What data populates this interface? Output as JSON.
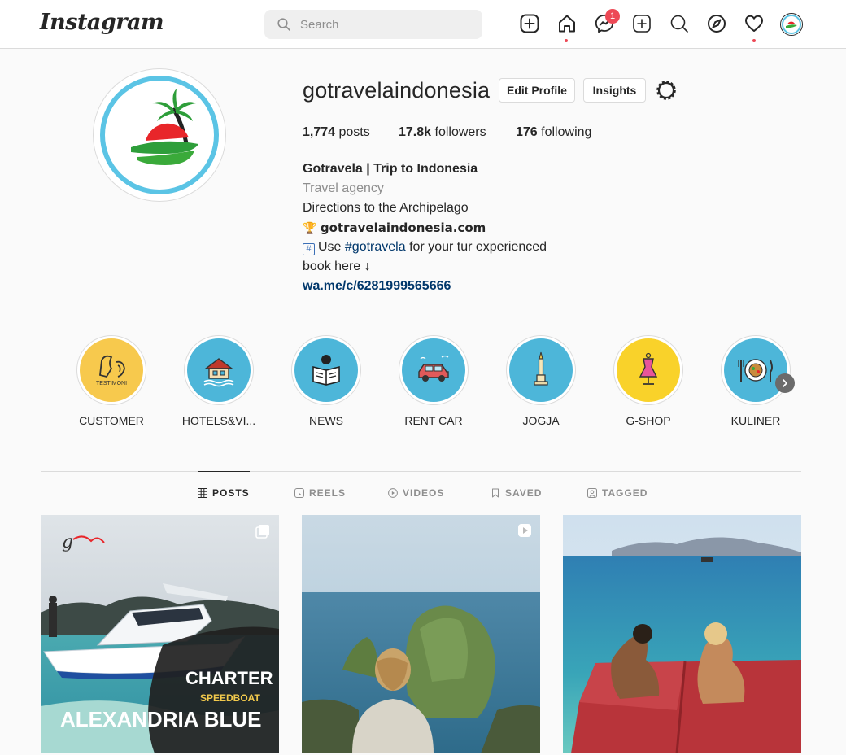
{
  "nav": {
    "logo": "Instagram",
    "search_placeholder": "Search",
    "messenger_badge": "1",
    "icons": [
      "new-post-icon",
      "home-icon",
      "messenger-icon",
      "create-icon",
      "search-icon",
      "explore-icon",
      "activity-heart-icon",
      "profile-avatar"
    ]
  },
  "profile": {
    "username": "gotravelaindonesia",
    "edit_profile_label": "Edit Profile",
    "insights_label": "Insights",
    "posts_count": "1,774",
    "posts_label": "posts",
    "followers_count": "17.8k",
    "followers_label": "followers",
    "following_count": "176",
    "following_label": "following",
    "bio": {
      "name": "Gotravela | Trip to Indonesia",
      "category": "Travel agency",
      "line1": "Directions to the Archipelago",
      "trophy_emoji": "🏆",
      "website_bold": "gotravelaindonesia.com",
      "hash_glyph": "#",
      "use_prefix": "Use",
      "hashtag": "#gotravela",
      "use_suffix": "for your tur experienced",
      "book_line": "book here ↓",
      "whatsapp_link": "wa.me/c/6281999565666"
    }
  },
  "highlights": [
    {
      "label": "CUSTOMER",
      "color": "#f7c94d",
      "inner_text": "TESTIMONI"
    },
    {
      "label": "HOTELS&VI...",
      "color": "#4db6d9"
    },
    {
      "label": "NEWS",
      "color": "#4db6d9"
    },
    {
      "label": "RENT CAR",
      "color": "#4db6d9"
    },
    {
      "label": "JOGJA",
      "color": "#4db6d9"
    },
    {
      "label": "G-SHOP",
      "color": "#f9d22a"
    },
    {
      "label": "KULINER",
      "color": "#4db6d9"
    }
  ],
  "tabs": [
    {
      "label": "POSTS",
      "icon": "grid-icon",
      "active": true
    },
    {
      "label": "REELS",
      "icon": "reels-icon",
      "active": false
    },
    {
      "label": "VIDEOS",
      "icon": "video-icon",
      "active": false
    },
    {
      "label": "SAVED",
      "icon": "bookmark-icon",
      "active": false
    },
    {
      "label": "TAGGED",
      "icon": "tag-icon",
      "active": false
    }
  ],
  "posts": [
    {
      "type": "carousel",
      "line1": "CHARTER",
      "line2": "SPEEDBOAT",
      "line3": "ALEXANDRIA BLUE"
    },
    {
      "type": "reel"
    },
    {
      "type": "photo"
    }
  ],
  "colors": {
    "accent_red": "#ed4956",
    "link_blue": "#00376b",
    "border": "#dbdbdb",
    "avatar_ring": "#5bc4e5"
  }
}
